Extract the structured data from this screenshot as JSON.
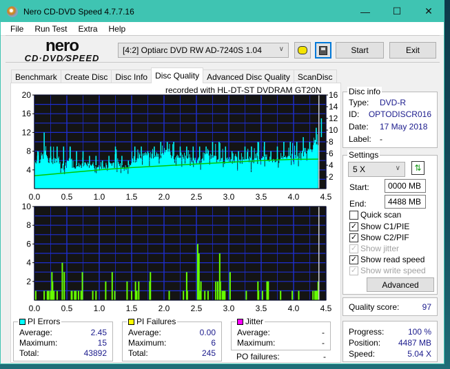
{
  "window": {
    "title": "Nero CD-DVD Speed 4.7.7.16",
    "controls": {
      "minimize": "—",
      "maximize": "☐",
      "close": "✕"
    }
  },
  "menu": [
    "File",
    "Run Test",
    "Extra",
    "Help"
  ],
  "logo": {
    "brand": "nero",
    "product": "CD·DVD⁄SPEED"
  },
  "toolbar": {
    "drive": "[4:2]  Optiarc DVD RW AD-7240S 1.04",
    "start_label": "Start",
    "exit_label": "Exit",
    "icons": [
      "disc-info-icon",
      "save-icon"
    ]
  },
  "tabs": [
    {
      "label": "Benchmark",
      "active": false
    },
    {
      "label": "Create Disc",
      "active": false
    },
    {
      "label": "Disc Info",
      "active": false
    },
    {
      "label": "Disc Quality",
      "active": true
    },
    {
      "label": "Advanced Disc Quality",
      "active": false
    },
    {
      "label": "ScanDisc",
      "active": false
    }
  ],
  "recorded_with": "recorded with HL-DT-ST DVDRAM GT20N",
  "disc_info": {
    "title": "Disc info",
    "rows": [
      {
        "label": "Type:",
        "value": "DVD-R"
      },
      {
        "label": "ID:",
        "value": "OPTODISCR016"
      },
      {
        "label": "Date:",
        "value": "17 May 2018"
      },
      {
        "label": "Label:",
        "value": "-"
      }
    ]
  },
  "settings": {
    "title": "Settings",
    "speed": "5 X",
    "start_label": "Start:",
    "start_value": "0000 MB",
    "end_label": "End:",
    "end_value": "4488 MB",
    "checkboxes": [
      {
        "label": "Quick scan",
        "checked": false,
        "enabled": true
      },
      {
        "label": "Show C1/PIE",
        "checked": true,
        "enabled": true
      },
      {
        "label": "Show C2/PIF",
        "checked": true,
        "enabled": true
      },
      {
        "label": "Show jitter",
        "checked": true,
        "enabled": false
      },
      {
        "label": "Show read speed",
        "checked": true,
        "enabled": true
      },
      {
        "label": "Show write speed",
        "checked": true,
        "enabled": false
      }
    ],
    "advanced_label": "Advanced"
  },
  "quality": {
    "label": "Quality score:",
    "value": "97"
  },
  "progress": {
    "rows": [
      {
        "label": "Progress:",
        "value": "100 %"
      },
      {
        "label": "Position:",
        "value": "4487 MB"
      },
      {
        "label": "Speed:",
        "value": "5.04 X"
      }
    ]
  },
  "stats": {
    "pi_errors": {
      "title": "PI Errors",
      "color": "#00ffff",
      "average_label": "Average:",
      "average": "2.45",
      "maximum_label": "Maximum:",
      "maximum": "15",
      "total_label": "Total:",
      "total": "43892"
    },
    "pi_failures": {
      "title": "PI Failures",
      "color": "#ffff00",
      "average_label": "Average:",
      "average": "0.00",
      "maximum_label": "Maximum:",
      "maximum": "6",
      "total_label": "Total:",
      "total": "245"
    },
    "jitter": {
      "title": "Jitter",
      "color": "#ff00ff",
      "average_label": "Average:",
      "average": "-",
      "maximum_label": "Maximum:",
      "maximum": "-"
    },
    "po_failures": {
      "label": "PO failures:",
      "value": "-"
    }
  },
  "chart_data": [
    {
      "type": "area",
      "title": "PI Errors",
      "x_ticks": [
        "0.0",
        "0.5",
        "1.0",
        "1.5",
        "2.0",
        "2.5",
        "3.0",
        "3.5",
        "4.0",
        "4.5"
      ],
      "y_ticks_left": [
        "20",
        "16",
        "12",
        "8",
        "4"
      ],
      "y_ticks_right": [
        "16",
        "14",
        "12",
        "10",
        "8",
        "6",
        "4",
        "2"
      ],
      "xlim": [
        0,
        4.5
      ],
      "ylim_left": [
        0,
        20
      ],
      "ylim_right": [
        0,
        16
      ],
      "series": [
        {
          "name": "PI Errors",
          "color": "#00ffff",
          "x": [
            0.0,
            0.1,
            0.2,
            0.3,
            0.4,
            0.5,
            0.6,
            0.7,
            0.8,
            0.9,
            1.0,
            1.1,
            1.2,
            1.3,
            1.4,
            1.5,
            1.6,
            1.7,
            1.8,
            1.9,
            2.0,
            2.1,
            2.2,
            2.3,
            2.4,
            2.5,
            2.6,
            2.7,
            2.8,
            2.9,
            3.0,
            3.1,
            3.2,
            3.3,
            3.4,
            3.5,
            3.6,
            3.7,
            3.8,
            3.9,
            4.0,
            4.1,
            4.2,
            4.3,
            4.38
          ],
          "values": [
            6,
            7,
            6,
            6,
            5,
            6,
            5,
            5,
            5,
            5,
            5,
            5,
            6,
            5,
            5,
            6,
            7,
            7,
            7,
            7,
            8,
            7,
            7,
            7,
            6,
            6,
            7,
            7,
            6,
            6,
            6,
            6,
            6,
            6,
            7,
            7,
            6,
            6,
            7,
            7,
            7,
            8,
            8,
            10,
            11
          ],
          "peaks": [
            8,
            12,
            9,
            9,
            9,
            9,
            8,
            8,
            7,
            7,
            6,
            7,
            9,
            7,
            6,
            9,
            9,
            8,
            9,
            10,
            10,
            10,
            9,
            9,
            9,
            9,
            9,
            10,
            10,
            9,
            8,
            8,
            9,
            9,
            10,
            10,
            8,
            9,
            10,
            10,
            10,
            11,
            10,
            13,
            15
          ]
        },
        {
          "name": "Read Speed",
          "color": "#00c800",
          "axis": "right",
          "x": [
            0.0,
            0.5,
            1.0,
            1.5,
            2.0,
            2.5,
            3.0,
            3.5,
            4.0,
            4.38
          ],
          "values": [
            2.2,
            2.7,
            3.2,
            3.6,
            3.9,
            4.2,
            4.5,
            4.8,
            5.0,
            5.04
          ]
        }
      ]
    },
    {
      "type": "bar",
      "title": "PI Failures",
      "x_ticks": [
        "0.0",
        "0.5",
        "1.0",
        "1.5",
        "2.0",
        "2.5",
        "3.0",
        "3.5",
        "4.0",
        "4.5"
      ],
      "y_ticks": [
        "10",
        "8",
        "6",
        "4",
        "2"
      ],
      "xlim": [
        0,
        4.5
      ],
      "ylim": [
        0,
        10
      ],
      "series": [
        {
          "name": "PI Failures",
          "color": "#66ff00",
          "x": [
            0.02,
            0.15,
            0.2,
            0.22,
            0.25,
            0.27,
            0.28,
            0.3,
            0.35,
            0.43,
            0.46,
            0.57,
            0.58,
            0.62,
            0.64,
            0.68,
            0.72,
            0.74,
            0.9,
            0.95,
            1.1,
            1.2,
            1.24,
            1.43,
            1.5,
            1.56,
            1.58,
            1.61,
            1.78,
            1.79,
            2.08,
            2.3,
            2.35,
            2.36,
            2.52,
            2.54,
            2.56,
            2.57,
            2.63,
            2.68,
            2.8,
            2.83,
            2.86,
            2.87,
            2.9,
            2.92,
            2.94,
            3.02,
            3.27,
            3.45,
            3.46,
            3.52,
            3.59,
            3.6,
            3.61,
            3.8,
            3.98,
            4.08,
            4.3,
            4.33,
            4.35,
            4.36,
            4.38
          ],
          "values": [
            1,
            1,
            1,
            1,
            1,
            3,
            2,
            1,
            1,
            4,
            3,
            1,
            1,
            1,
            1,
            1,
            1,
            3,
            1,
            1,
            2,
            3,
            1,
            2,
            1,
            2,
            1,
            2,
            2,
            3,
            1,
            1,
            3,
            1,
            6,
            5,
            1,
            2,
            1,
            1,
            2,
            2,
            5,
            2,
            1,
            1,
            1,
            3,
            1,
            2,
            1,
            1,
            2,
            2,
            2,
            1,
            1,
            1,
            1,
            1,
            1,
            1,
            2
          ]
        }
      ]
    }
  ]
}
